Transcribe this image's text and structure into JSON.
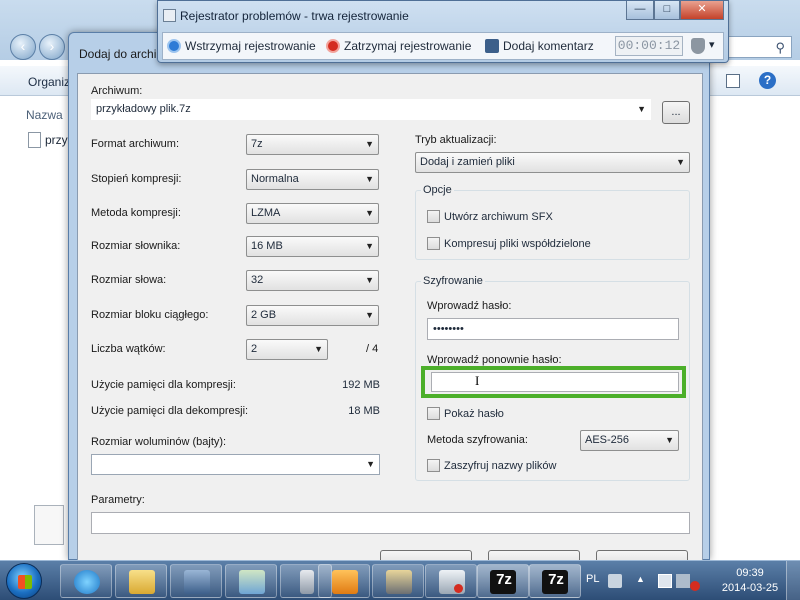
{
  "explorer": {
    "toolbar_organize": "Organiz",
    "column_name": "Nazwa",
    "file_partial": "przy"
  },
  "dialog": {
    "title": "Dodaj do archi",
    "archive_label": "Archiwum:",
    "archive_value": "przykładowy plik.7z",
    "browse_label": "...",
    "format_label": "Format archiwum:",
    "format_value": "7z",
    "level_label": "Stopień kompresji:",
    "level_value": "Normalna",
    "method_label": "Metoda kompresji:",
    "method_value": "LZMA",
    "dict_label": "Rozmiar słownika:",
    "dict_value": "16 MB",
    "word_label": "Rozmiar słowa:",
    "word_value": "32",
    "block_label": "Rozmiar bloku ciągłego:",
    "block_value": "2 GB",
    "threads_label": "Liczba wątków:",
    "threads_value": "2",
    "threads_max": "/ 4",
    "mem_compress_label": "Użycie pamięci dla kompresji:",
    "mem_compress_value": "192 MB",
    "mem_decompress_label": "Użycie pamięci dla dekompresji:",
    "mem_decompress_value": "18 MB",
    "volumes_label": "Rozmiar woluminów (bajty):",
    "volumes_value": "",
    "params_label": "Parametry:",
    "params_value": "",
    "update_label": "Tryb aktualizacji:",
    "update_value": "Dodaj i zamień pliki",
    "options_title": "Opcje",
    "opt_sfx": "Utwórz archiwum SFX",
    "opt_shared": "Kompresuj pliki współdzielone",
    "enc_title": "Szyfrowanie",
    "enc_pw_label": "Wprowadź hasło:",
    "enc_pw_value": "••••••••",
    "enc_pw2_label": "Wprowadź ponownie hasło:",
    "enc_pw2_value": "",
    "enc_show": "Pokaż hasło",
    "enc_method_label": "Metoda szyfrowania:",
    "enc_method_value": "AES-256",
    "enc_names": "Zaszyfruj nazwy plików"
  },
  "recorder": {
    "title": "Rejestrator problemów - trwa rejestrowanie",
    "pause": "Wstrzymaj rejestrowanie",
    "stop": "Zatrzymaj rejestrowanie",
    "comment": "Dodaj komentarz",
    "timer": "00:00:12",
    "minimize": "—",
    "maximize": "□",
    "close": "✕",
    "help_dropdown": "▾"
  },
  "taskbar": {
    "items": [
      "Internet Explorer",
      "Eksplorator Windows",
      "Sieć",
      "Panel sterowania",
      "Kalkulator",
      "Outlook",
      "Rejestrator problemów",
      "Narzędzie",
      "7-Zip",
      "7-Zip"
    ],
    "seven_zip_label": "7z",
    "lang": "PL",
    "time": "09:39",
    "date": "2014-03-25"
  },
  "colors": {
    "highlight": "#4caf2a",
    "dialog_frame": "#b7cfe8",
    "taskbar": "#2d4d76"
  }
}
